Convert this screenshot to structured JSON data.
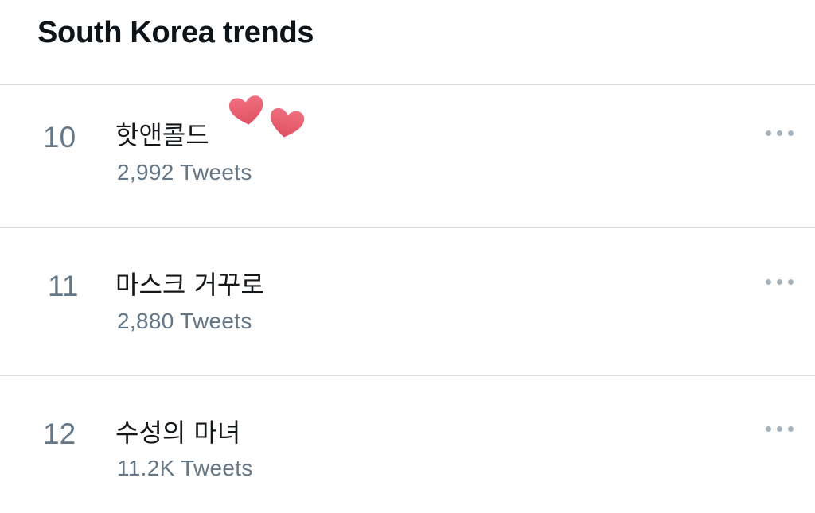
{
  "header": {
    "title": "South Korea trends"
  },
  "trends": [
    {
      "rank": "10",
      "name": "핫앤콜드",
      "tweets": "2,992 Tweets"
    },
    {
      "rank": "11",
      "name": "마스크 거꾸로",
      "tweets": "2,880 Tweets"
    },
    {
      "rank": "12",
      "name": "수성의 마녀",
      "tweets": "11.2K Tweets"
    }
  ],
  "icons": {
    "more": "more-horizontal-icon",
    "stickers": "hearts-sticker"
  },
  "colors": {
    "text_primary": "#14171a",
    "text_secondary": "#657786",
    "divider": "#d9dee2",
    "heart": "#e75b6c"
  }
}
